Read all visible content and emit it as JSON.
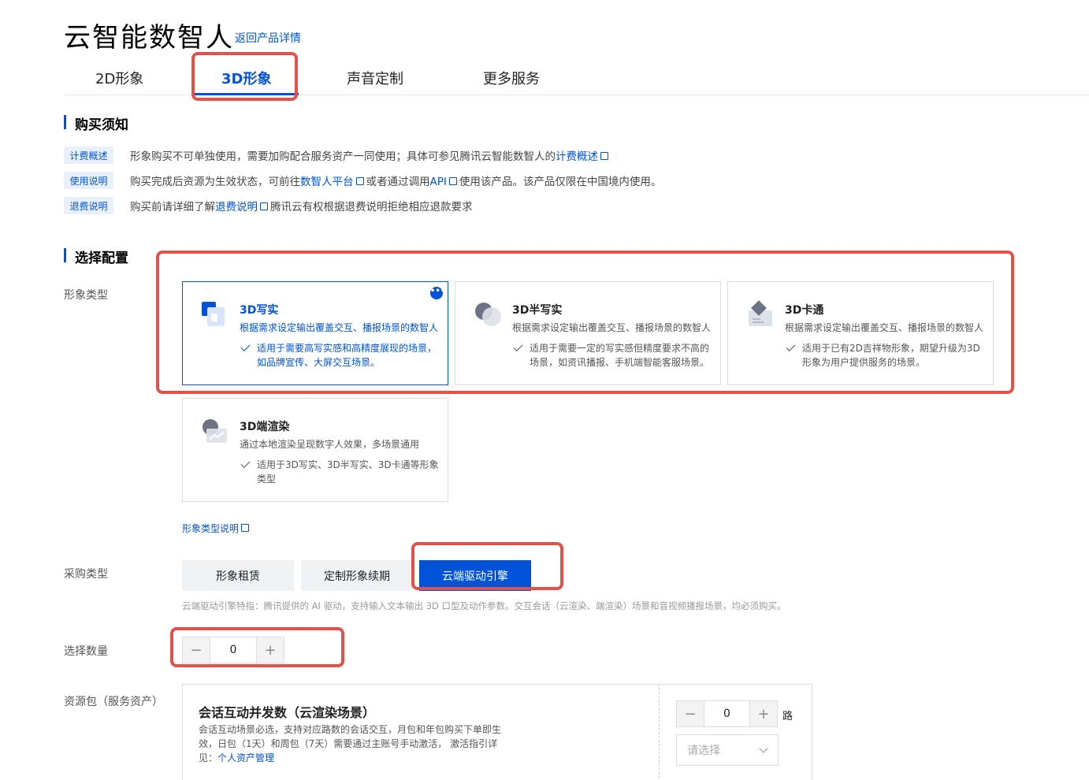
{
  "header": {
    "title": "云智能数智人",
    "back_link": "返回产品详情"
  },
  "tabs": [
    {
      "label": "2D形象",
      "active": false
    },
    {
      "label": "3D形象",
      "active": true
    },
    {
      "label": "声音定制",
      "active": false
    },
    {
      "label": "更多服务",
      "active": false
    }
  ],
  "notice": {
    "title": "购买须知",
    "rows": [
      {
        "tag": "计费概述",
        "text_a": "形象购买不可单独使用，需要加购配合服务资产一同使用；具体可参见腾讯云智能数智人的",
        "link_a": "计费概述",
        "text_b": "",
        "link_b": "",
        "text_c": ""
      },
      {
        "tag": "使用说明",
        "text_a": "购买完成后资源为生效状态，可前往",
        "link_a": "数智人平台",
        "text_b": "或者通过调用",
        "link_b": "API",
        "text_c": "使用该产品。该产品仅限在中国境内使用。"
      },
      {
        "tag": "退费说明",
        "text_a": "购买前请详细了解",
        "link_a": "退费说明",
        "text_b": "腾讯云有权根据退费说明拒绝相应退款要求",
        "link_b": "",
        "text_c": ""
      }
    ]
  },
  "config": {
    "title": "选择配置",
    "image_type_label": "形象类型",
    "cards": [
      {
        "title": "3D写实",
        "desc": "根据需求设定输出覆盖交互、播报场景的数智人",
        "feature": "适用于需要高写实感和高精度展现的场景，如品牌宣传、大屏交互场景。",
        "more": "•••"
      },
      {
        "title": "3D半写实",
        "desc": "根据需求设定输出覆盖交互、播报场景的数智人",
        "feature": "适用于需要一定的写实感但精度要求不高的场景，如资讯播报、手机端智能客服场景。"
      },
      {
        "title": "3D卡通",
        "desc": "根据需求设定输出覆盖交互、播报场景的数智人",
        "feature": "适用于已有2D吉祥物形象，期望升级为3D形象为用户提供服务的场景。"
      },
      {
        "title": "3D端渲染",
        "desc": "通过本地渲染呈现数字人效果，多场景通用",
        "feature": "适用于3D写实、3D半写实、3D卡通等形象类型"
      }
    ],
    "image_type_help": "形象类型说明",
    "purchase_label": "采购类型",
    "purchase_types": [
      "形象租赁",
      "定制形象续期",
      "云端驱动引擎"
    ],
    "purchase_hint": "云端驱动引擎特指：腾讯提供的 AI 驱动，支持输入文本输出 3D 口型及动作参数。交互会话（云渲染、端渲染）场景和音视频播报场景，均必须购买。",
    "quantity_label": "选择数量",
    "quantity": "0",
    "resource_label": "资源包（服务资产）",
    "resource": {
      "title": "会话互动并发数（云渲染场景）",
      "desc": "会话互动场景必选，支持对应路数的会话交互，月包和年包购买下单即生效，日包（1天）和周包（7天）需要通过主账号手动激活， 激活指引详见：",
      "link": "个人资产管理",
      "qty": "0",
      "unit": "路",
      "select_placeholder": "请选择"
    }
  },
  "stepper_symbols": {
    "minus": "−",
    "plus": "+"
  },
  "colors": {
    "accent": "#0052d9",
    "highlight": "#e0524b"
  }
}
